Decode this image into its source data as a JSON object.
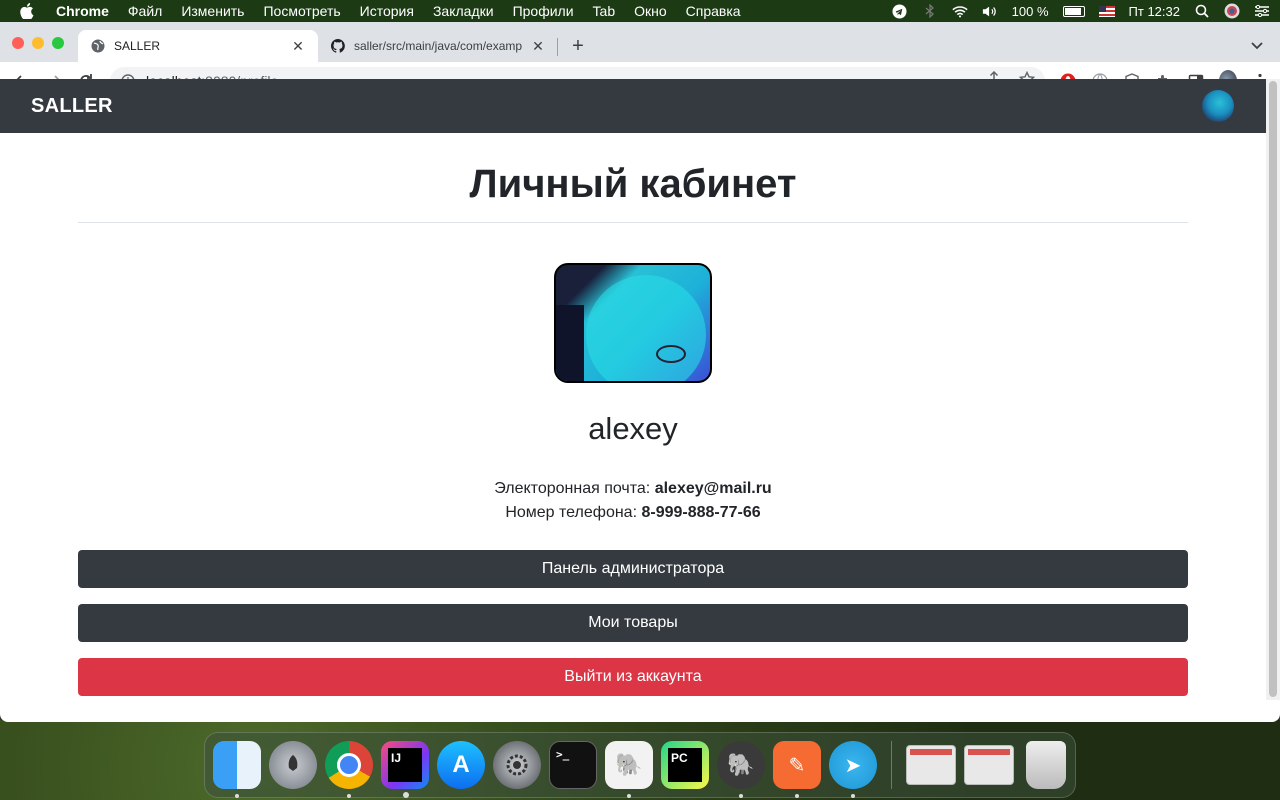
{
  "menubar": {
    "app_name": "Chrome",
    "items": [
      "Файл",
      "Изменить",
      "Посмотреть",
      "История",
      "Закладки",
      "Профили",
      "Tab",
      "Окно",
      "Справка"
    ],
    "battery_text": "100 %",
    "clock": "Пт 12:32"
  },
  "browser": {
    "tabs": [
      {
        "title": "SALLER",
        "active": true
      },
      {
        "title": "saller/src/main/java/com/examp",
        "active": false
      }
    ],
    "url_host": "localhost",
    "url_rest": ":8080/profile"
  },
  "site": {
    "brand": "SALLER",
    "page_title": "Личный кабинет",
    "username": "alexey",
    "email_label": "Электоронная почта:",
    "email_value": "alexey@mail.ru",
    "phone_label": "Номер телефона:",
    "phone_value": "8-999-888-77-66",
    "buttons": {
      "admin_panel": "Панель администратора",
      "my_products": "Мои товары",
      "logout": "Выйти из аккаунта"
    }
  },
  "dock": {
    "apps": [
      "finder",
      "launchpad",
      "chrome",
      "intellij-idea",
      "app-store",
      "system-preferences",
      "terminal",
      "tableplus",
      "pycharm",
      "sequel",
      "postman",
      "telegram"
    ],
    "intellij_label": "IJ",
    "pycharm_label": "PC",
    "terminal_label": ">_"
  },
  "colors": {
    "navbar": "#343a40",
    "danger": "#dc3545",
    "dark_button": "#343a40"
  }
}
